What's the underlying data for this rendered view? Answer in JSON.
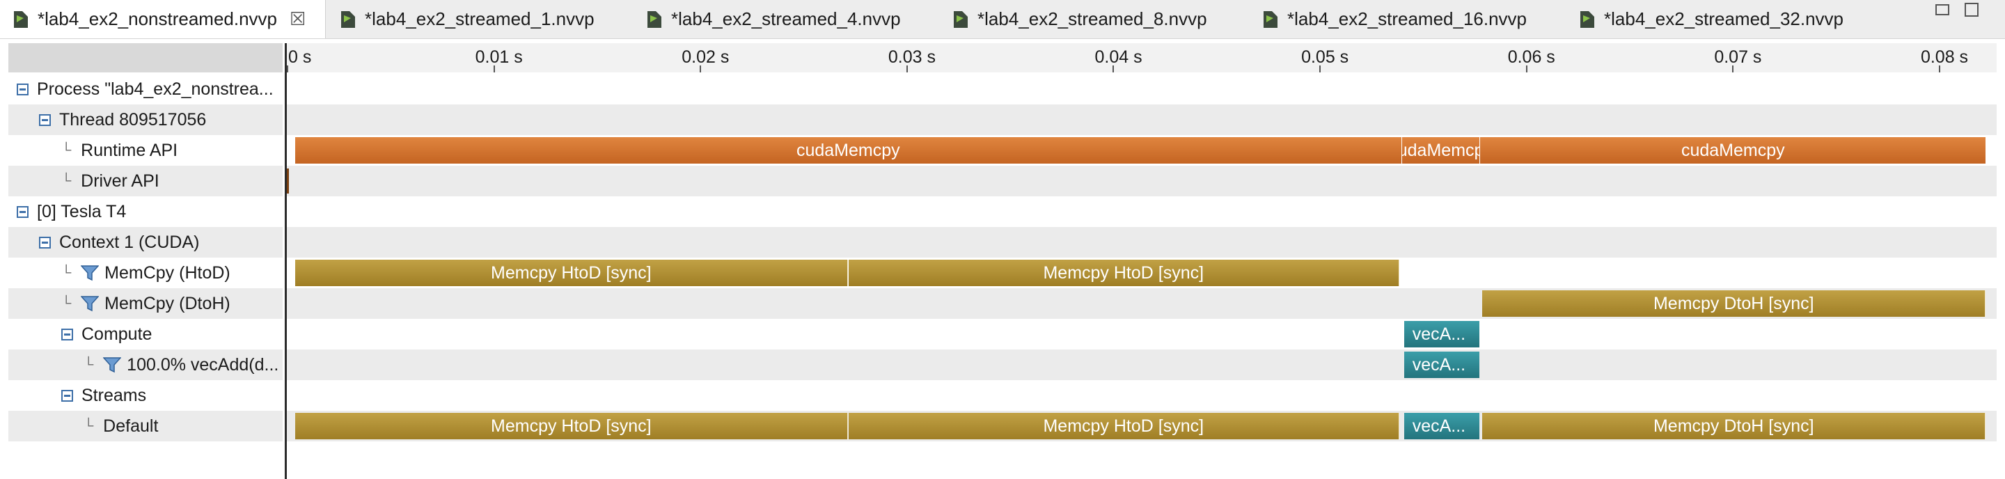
{
  "tabs": [
    {
      "label": "*lab4_ex2_nonstreamed.nvvp",
      "active": true,
      "closable": true
    },
    {
      "label": "*lab4_ex2_streamed_1.nvvp"
    },
    {
      "label": "*lab4_ex2_streamed_4.nvvp"
    },
    {
      "label": "*lab4_ex2_streamed_8.nvvp"
    },
    {
      "label": "*lab4_ex2_streamed_16.nvvp"
    },
    {
      "label": "*lab4_ex2_streamed_32.nvvp"
    }
  ],
  "window_controls": [
    "minimize-icon",
    "maximize-icon"
  ],
  "tab_close_icon": "☒",
  "tree": [
    {
      "label": "Process \"lab4_ex2_nonstrea...",
      "icon": "collapse-icon"
    },
    {
      "label": "Thread 809517056",
      "icon": "collapse-icon"
    },
    {
      "label": "Runtime API",
      "icon": "elbow"
    },
    {
      "label": "Driver API",
      "icon": "elbow"
    },
    {
      "label": "[0] Tesla T4",
      "icon": "collapse-icon"
    },
    {
      "label": "Context 1 (CUDA)",
      "icon": "collapse-icon"
    },
    {
      "label": "MemCpy (HtoD)",
      "icon": "filter-icon"
    },
    {
      "label": "MemCpy (DtoH)",
      "icon": "filter-icon"
    },
    {
      "label": "Compute",
      "icon": "collapse-icon"
    },
    {
      "label": "100.0% vecAdd(d...",
      "icon": "filter-icon"
    },
    {
      "label": "Streams",
      "icon": "collapse-icon"
    },
    {
      "label": "Default",
      "icon": "elbow"
    }
  ],
  "ruler": {
    "ticks": [
      "0 s",
      "0.01 s",
      "0.02 s",
      "0.03 s",
      "0.04 s",
      "0.05 s",
      "0.06 s",
      "0.07 s",
      "0.08 s"
    ],
    "tick_values": [
      0,
      0.01,
      0.02,
      0.03,
      0.04,
      0.05,
      0.06,
      0.07,
      0.08
    ]
  },
  "timeline": {
    "time_range_s": [
      0,
      0.0828
    ],
    "colors": {
      "runtime_api": "#d2722e",
      "memcpy": "#b08f35",
      "kernel": "#2e8a94"
    },
    "rows": [
      {
        "row": 2,
        "kind": "api",
        "segments": [
          {
            "label": "cudaMemcpy",
            "start": 0.0004,
            "end": 0.054
          },
          {
            "label": "cudaMemcpy",
            "start": 0.054,
            "end": 0.0578
          },
          {
            "label": "cudaMemcpy",
            "start": 0.0578,
            "end": 0.0823
          }
        ]
      },
      {
        "row": 6,
        "kind": "mem",
        "segments": [
          {
            "label": "Memcpy HtoD [sync]",
            "start": 0.0004,
            "end": 0.0272
          },
          {
            "label": "Memcpy HtoD [sync]",
            "start": 0.0272,
            "end": 0.0539
          }
        ]
      },
      {
        "row": 7,
        "kind": "mem",
        "segments": [
          {
            "label": "Memcpy DtoH [sync]",
            "start": 0.0579,
            "end": 0.0823
          }
        ]
      },
      {
        "row": 8,
        "kind": "kern",
        "segments": [
          {
            "label": "vecA...",
            "start": 0.0541,
            "end": 0.0578
          }
        ]
      },
      {
        "row": 9,
        "kind": "kern",
        "segments": [
          {
            "label": "vecA...",
            "start": 0.0541,
            "end": 0.0578
          }
        ]
      },
      {
        "row": 11,
        "kind": "mem",
        "segments": [
          {
            "label": "Memcpy HtoD [sync]",
            "start": 0.0004,
            "end": 0.0272
          },
          {
            "label": "Memcpy HtoD [sync]",
            "start": 0.0272,
            "end": 0.0539
          }
        ]
      },
      {
        "row": 11,
        "kind": "kern",
        "segments": [
          {
            "label": "vecA...",
            "start": 0.0541,
            "end": 0.0578
          }
        ]
      },
      {
        "row": 11,
        "kind": "mem",
        "segments": [
          {
            "label": "Memcpy DtoH [sync]",
            "start": 0.0579,
            "end": 0.0823
          }
        ]
      }
    ]
  }
}
